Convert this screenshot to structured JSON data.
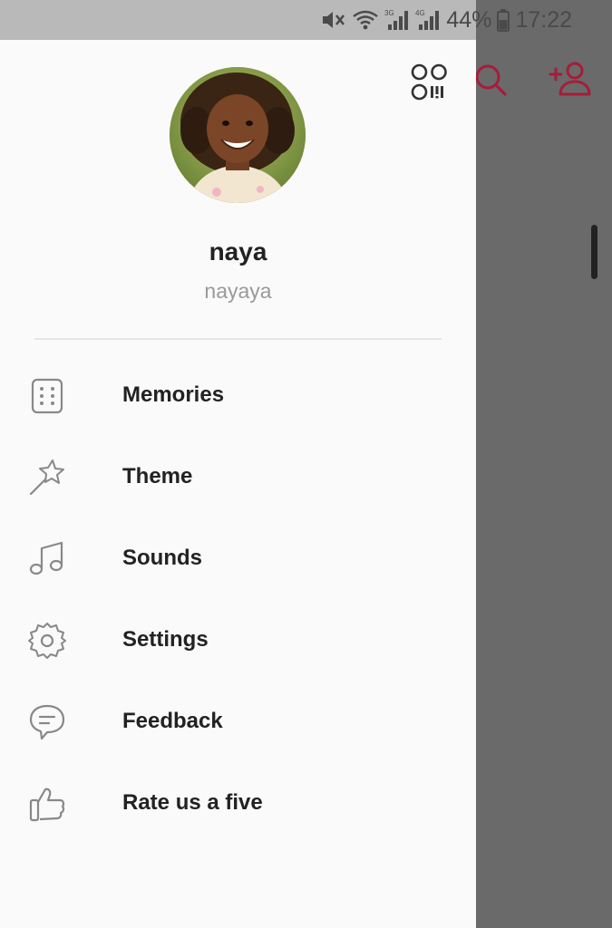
{
  "status_bar": {
    "battery_percent": "44%",
    "time": "17:22",
    "network_1": "3G",
    "network_2": "4G",
    "icons": [
      "mute-icon",
      "wifi-icon",
      "signal-3g-icon",
      "signal-4g-icon",
      "battery-icon"
    ]
  },
  "background_header": {
    "icons": [
      "search-icon",
      "add-friend-icon"
    ],
    "accent_color": "#a51d3a"
  },
  "drawer": {
    "qr_icon": "qr-code-icon",
    "profile": {
      "name": "naya",
      "username": "nayaya"
    },
    "menu": [
      {
        "label": "Memories",
        "icon": "memories-icon"
      },
      {
        "label": "Theme",
        "icon": "magic-wand-icon"
      },
      {
        "label": "Sounds",
        "icon": "music-note-icon"
      },
      {
        "label": "Settings",
        "icon": "gear-icon"
      },
      {
        "label": "Feedback",
        "icon": "chat-bubble-icon"
      },
      {
        "label": "Rate us a five",
        "icon": "thumbs-up-icon"
      }
    ]
  }
}
